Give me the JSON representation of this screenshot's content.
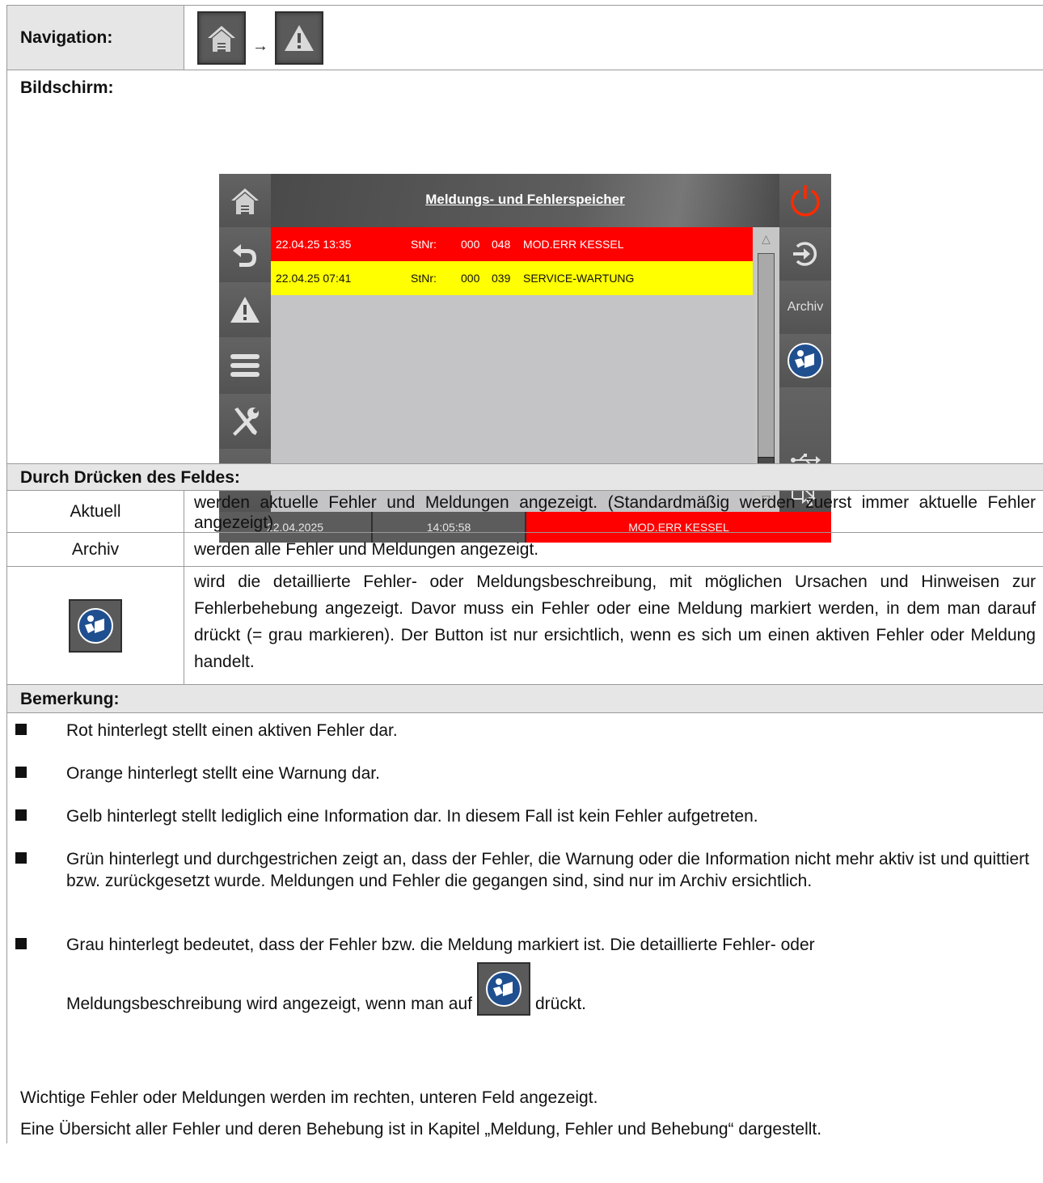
{
  "navigation": {
    "label": "Navigation:",
    "arrow": "→",
    "buttons": [
      {
        "icon": "home-icon"
      },
      {
        "icon": "warning-icon"
      }
    ]
  },
  "screen_section": {
    "label": "Bildschirm:",
    "title": "Meldungs- und Fehlerspeicher",
    "entries": [
      {
        "date": "22.04.25 13:35",
        "stnr": "StNr:",
        "n1": "000",
        "n2": "048",
        "text": "MOD.ERR KESSEL",
        "color": "#ff0000"
      },
      {
        "date": "22.04.25 07:41",
        "stnr": "StNr:",
        "n1": "000",
        "n2": "039",
        "text": "SERVICE-WARTUNG",
        "color": "#ffff00"
      }
    ],
    "right_archiv": "Archiv",
    "status": {
      "date": "22.04.2025",
      "time": "14:05:58",
      "message": "MOD.ERR KESSEL"
    },
    "colors": {
      "power": "#ff2a00",
      "error": "#ff0000",
      "info": "#ffff00",
      "bg": "#5c5c5c",
      "list": "#c4c3c5"
    }
  },
  "press_section": {
    "header": "Durch Drücken des Feldes:",
    "rows": [
      {
        "key": "Aktuell",
        "desc": "werden aktuelle Fehler und Meldungen angezeigt. (Standardmäßig werden zuerst immer aktuelle Fehler angezeigt)"
      },
      {
        "key": "Archiv",
        "desc": "werden alle Fehler und Meldungen angezeigt."
      },
      {
        "key_icon": "manual-reader-icon",
        "desc": "wird die detaillierte Fehler- oder Meldungsbeschreibung, mit möglichen Ursachen und Hinweisen zur Fehlerbehebung angezeigt. Davor muss ein Fehler oder eine Meldung markiert werden, in dem man darauf drückt (= grau markieren). Der Button ist nur ersichtlich, wenn es sich um einen aktiven Fehler oder Meldung handelt."
      }
    ]
  },
  "remarks": {
    "header": "Bemerkung:",
    "bullets": [
      "Rot hinterlegt stellt einen aktiven Fehler dar.",
      "Orange hinterlegt stellt eine Warnung dar.",
      "Gelb hinterlegt stellt lediglich eine Information dar. In diesem Fall ist kein Fehler aufgetreten.",
      "Grün hinterlegt und durchgestrichen zeigt an, dass der Fehler, die Warnung oder die Information nicht mehr aktiv ist und quittiert bzw. zurückgesetzt wurde. Meldungen und Fehler die gegangen sind, sind nur im Archiv ersichtlich."
    ],
    "last_bullet_line1": "Grau hinterlegt bedeutet, dass der Fehler bzw. die Meldung markiert ist. Die detaillierte Fehler- oder",
    "last_bullet_line2a": "Meldungsbeschreibung wird angezeigt, wenn man auf",
    "last_bullet_line2b": "drückt.",
    "para1": "Wichtige Fehler oder Meldungen werden im rechten, unteren Feld angezeigt.",
    "para2": "Eine Übersicht aller Fehler und deren Behebung ist in Kapitel „Meldung, Fehler und Behebung“ dargestellt."
  }
}
